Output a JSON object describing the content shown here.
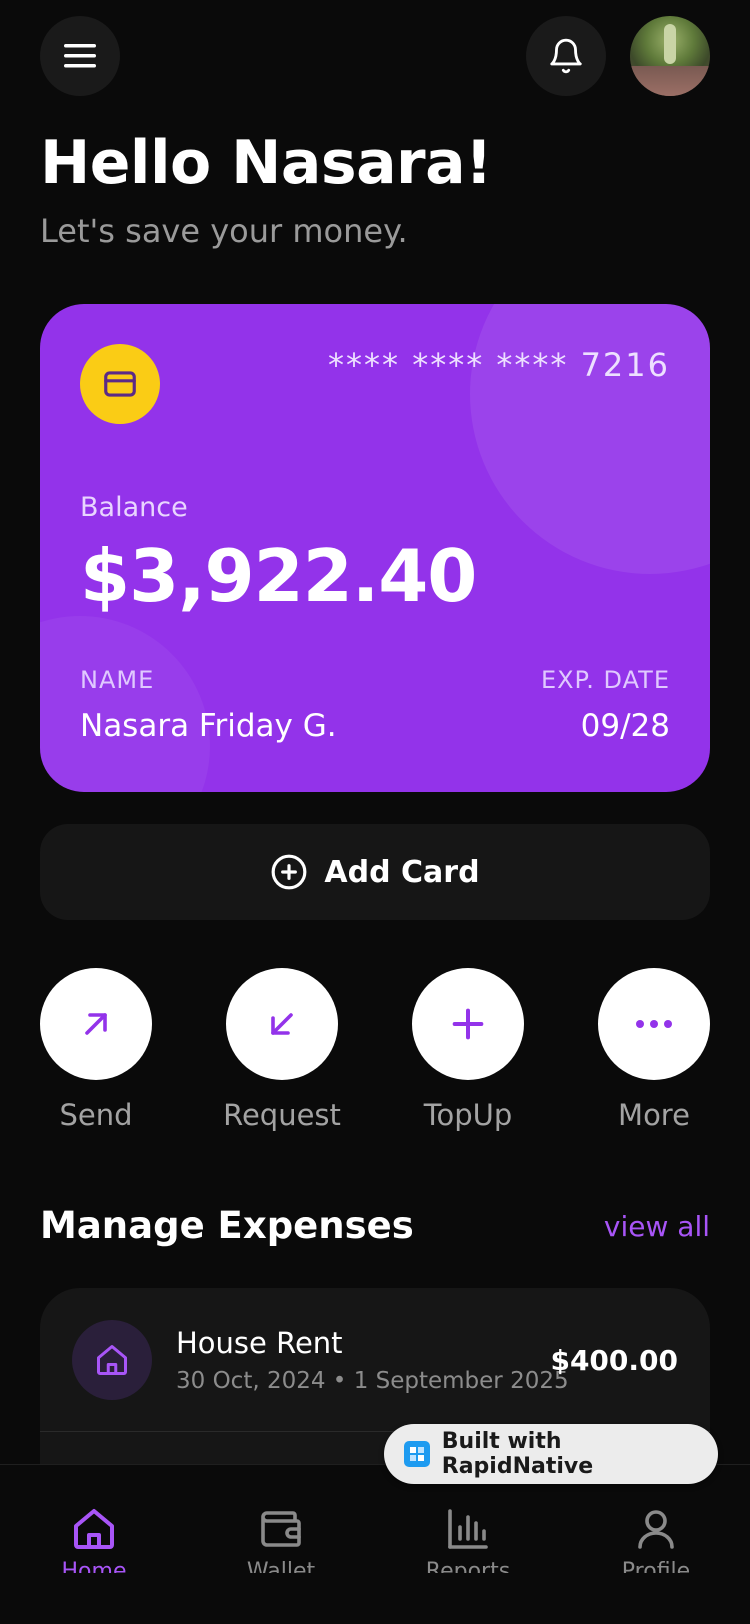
{
  "header": {
    "greeting": "Hello Nasara!",
    "subtitle": "Let's save your money."
  },
  "card": {
    "number": "**** **** **** 7216",
    "balance_label": "Balance",
    "balance": "$3,922.40",
    "name_label": "NAME",
    "name": "Nasara Friday G.",
    "exp_label": "EXP. DATE",
    "exp": "09/28",
    "color": "#9333ea",
    "chip_color": "#facc15"
  },
  "add_card": {
    "label": "Add Card"
  },
  "actions": [
    {
      "label": "Send",
      "icon": "arrow-up-right-icon"
    },
    {
      "label": "Request",
      "icon": "arrow-down-left-icon"
    },
    {
      "label": "TopUp",
      "icon": "plus-icon"
    },
    {
      "label": "More",
      "icon": "more-dots-icon"
    }
  ],
  "expenses": {
    "title": "Manage Expenses",
    "view_all": "view all",
    "items": [
      {
        "title": "House Rent",
        "date": "30 Oct, 2024 • 1 September 2025",
        "amount": "$400.00",
        "icon": "home-icon"
      }
    ]
  },
  "badge": {
    "label": "Built with RapidNative"
  },
  "tabs": [
    {
      "label": "Home",
      "icon": "home-icon",
      "active": true
    },
    {
      "label": "Wallet",
      "icon": "wallet-icon",
      "active": false
    },
    {
      "label": "Reports",
      "icon": "bar-chart-icon",
      "active": false
    },
    {
      "label": "Profile",
      "icon": "user-icon",
      "active": false
    }
  ],
  "colors": {
    "accent": "#a855f7",
    "background": "#0a0a0a",
    "surface": "#161616"
  }
}
